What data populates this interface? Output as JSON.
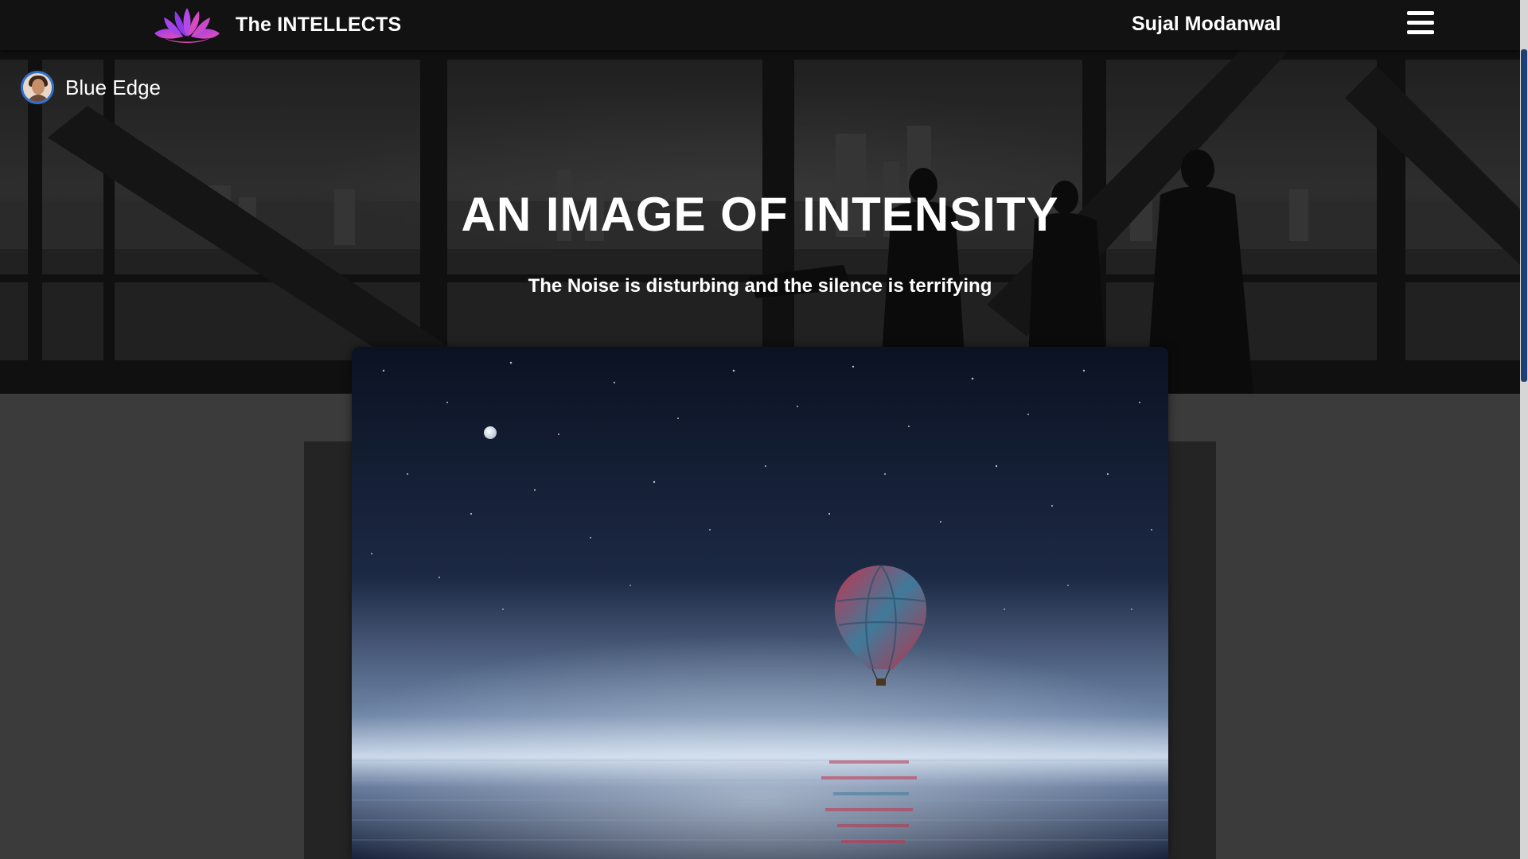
{
  "navbar": {
    "brand_name": "The INTELLECTS",
    "user_name": "Sujal Modanwal",
    "logo_icon": "lotus-icon",
    "menu_icon": "hamburger-menu-icon"
  },
  "channel": {
    "name": "Blue Edge",
    "avatar_icon": "avatar"
  },
  "hero": {
    "title": "AN IMAGE OF INTENSITY",
    "subtitle": "The Noise is disturbing and the silence is terrifying"
  },
  "feature_image": {
    "subject": "hot-air-balloon-over-sea-at-night"
  },
  "colors": {
    "navbar_bg": "#121212",
    "page_bg": "#3b3b3b",
    "accent_purple": "#b44ae6",
    "accent_pink": "#e04ab5",
    "scroll_thumb": "#1e3f73"
  }
}
